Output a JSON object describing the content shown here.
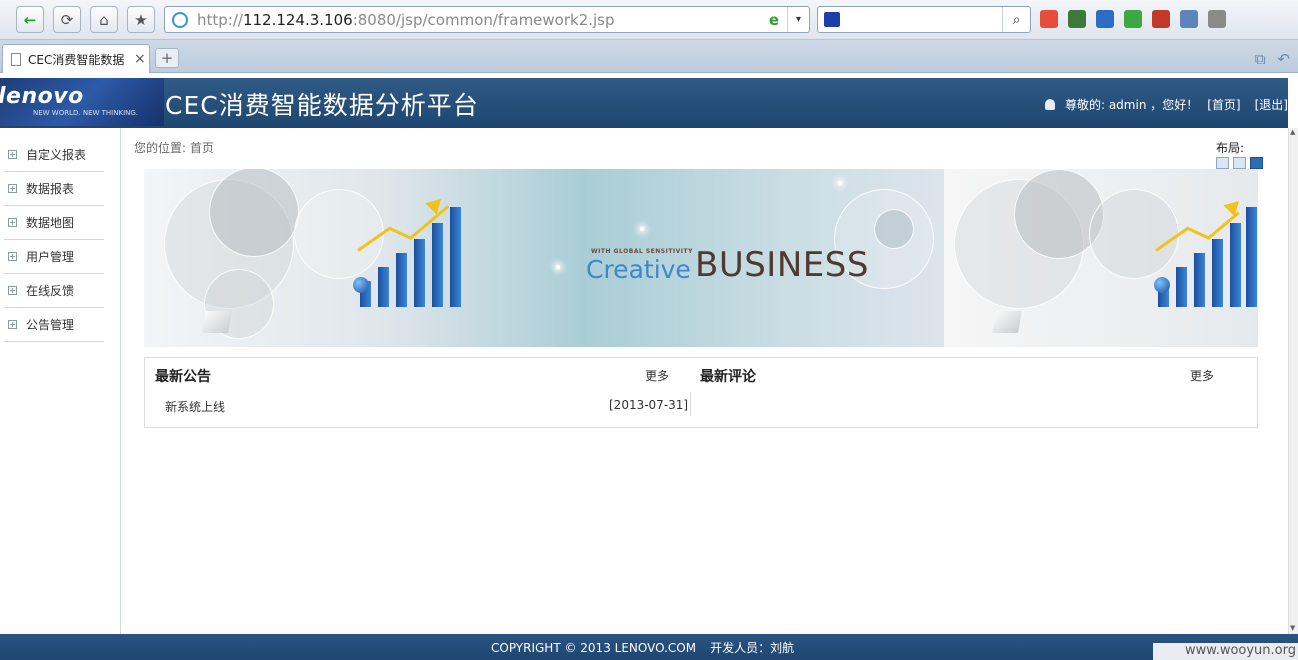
{
  "browser": {
    "url_scheme": "http://",
    "url_host": "112.124.3.106",
    "url_path": ":8080/jsp/common/framework2.jsp",
    "tab_title": "CEC消费智能数据",
    "tab_close": "×",
    "new_tab": "+",
    "back_glyph": "←",
    "refresh_glyph": "⟳",
    "home_glyph": "⌂",
    "favorite_glyph": "★",
    "search_glyph": "⌕",
    "dropdown_glyph": "▾",
    "ie_glyph": "e",
    "tab_icons": [
      "⧉",
      "↶"
    ]
  },
  "header": {
    "logo_word": "lenovo",
    "logo_tagline": "NEW WORLD. NEW THINKING.",
    "title": "CEC消费智能数据分析平台",
    "greeting": "尊敬的: admin ，您好！",
    "home_link": "[首页]",
    "logout_link": "[退出]"
  },
  "sidebar": {
    "items": [
      {
        "label": "自定义报表"
      },
      {
        "label": "数据报表"
      },
      {
        "label": "数据地图"
      },
      {
        "label": "用户管理"
      },
      {
        "label": "在线反馈"
      },
      {
        "label": "公告管理"
      }
    ]
  },
  "main": {
    "breadcrumb": "您的位置: 首页",
    "layout_label": "布局:",
    "banner": {
      "small_text": "WITH GLOBAL SENSITIVITY",
      "creative": "Creative",
      "business": "BUSINESS"
    },
    "notices": {
      "title": "最新公告",
      "more": "更多",
      "items": [
        {
          "title": "新系统上线",
          "date": "[2013-07-31]"
        }
      ]
    },
    "comments": {
      "title": "最新评论",
      "more": "更多"
    }
  },
  "footer": {
    "copyright": "COPYRIGHT © 2013 LENOVO.COM",
    "developer": "开发人员：刘航"
  },
  "watermark": "www.wooyun.org",
  "colors": {
    "header_blue": "#2f5b86",
    "accent_gold": "#f1c21b",
    "bar_blue": "#1c4f9e"
  }
}
